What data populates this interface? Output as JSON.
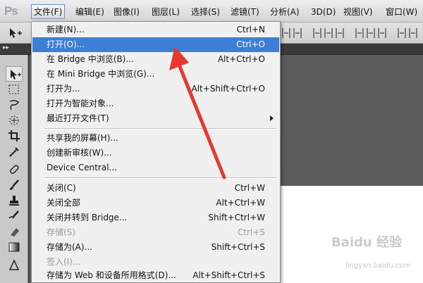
{
  "app": {
    "logo": "Ps",
    "accent_color": "#3d7fd6",
    "annotation_color": "#e8372d"
  },
  "menubar": {
    "items": [
      "文件(F)",
      "编辑(E)",
      "图像(I)",
      "图层(L)",
      "选择(S)",
      "滤镜(T)",
      "分析(A)",
      "3D(D)",
      "视图(V)",
      "窗口(W)"
    ],
    "active": "文件(F)"
  },
  "file_menu": {
    "groups": [
      [
        {
          "label": "新建(N)...",
          "shortcut": "Ctrl+N"
        },
        {
          "label": "打开(O)...",
          "shortcut": "Ctrl+O",
          "highlighted": true
        },
        {
          "label": "在 Bridge 中浏览(B)...",
          "shortcut": "Alt+Ctrl+O"
        },
        {
          "label": "在 Mini Bridge 中浏览(G)...",
          "shortcut": ""
        },
        {
          "label": "打开为...",
          "shortcut": "Alt+Shift+Ctrl+O"
        },
        {
          "label": "打开为智能对象...",
          "shortcut": ""
        },
        {
          "label": "最近打开文件(T)",
          "shortcut": "",
          "submenu": true
        }
      ],
      [
        {
          "label": "共享我的屏幕(H)...",
          "shortcut": ""
        },
        {
          "label": "创建新审核(W)...",
          "shortcut": ""
        },
        {
          "label": "Device Central...",
          "shortcut": ""
        }
      ],
      [
        {
          "label": "关闭(C)",
          "shortcut": "Ctrl+W"
        },
        {
          "label": "关闭全部",
          "shortcut": "Alt+Ctrl+W"
        },
        {
          "label": "关闭并转到 Bridge...",
          "shortcut": "Shift+Ctrl+W"
        },
        {
          "label": "存储(S)",
          "shortcut": "Ctrl+S",
          "disabled": true
        },
        {
          "label": "存储为(A)...",
          "shortcut": "Shift+Ctrl+S"
        },
        {
          "label": "签入(I)...",
          "shortcut": "",
          "disabled": true
        },
        {
          "label": "存储为 Web 和设备所用格式(D)...",
          "shortcut": "Alt+Shift+Ctrl+S"
        }
      ]
    ]
  },
  "watermark": {
    "text": "Baidu 经验",
    "sub": "jingyan.baidu.com"
  },
  "tools": [
    "move-tool-icon",
    "marquee-tool-icon",
    "lasso-tool-icon",
    "quick-selection-tool-icon",
    "crop-tool-icon",
    "eyedropper-tool-icon",
    "healing-brush-tool-icon",
    "brush-tool-icon",
    "clone-stamp-tool-icon",
    "history-brush-tool-icon",
    "eraser-tool-icon",
    "gradient-tool-icon",
    "blur-tool-icon"
  ]
}
